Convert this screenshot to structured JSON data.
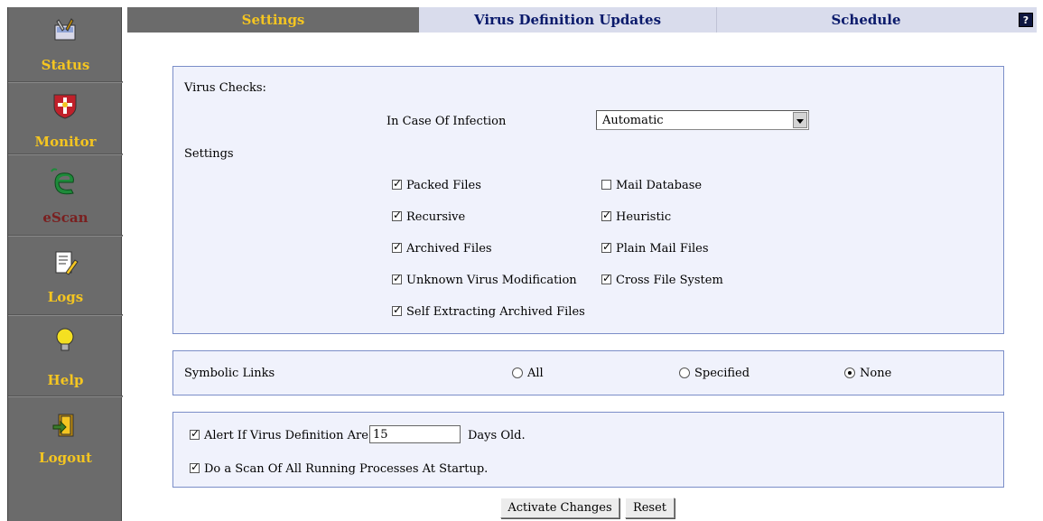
{
  "sidebar": {
    "items": [
      {
        "label": "Status",
        "icon": "tools-icon",
        "color": "#f4c521"
      },
      {
        "label": "Monitor",
        "icon": "shield-icon",
        "color": "#f4c521"
      },
      {
        "label": "eScan",
        "icon": "escan-logo-icon",
        "color": "#7a1f1f"
      },
      {
        "label": "Logs",
        "icon": "document-pencil-icon",
        "color": "#f4c521"
      },
      {
        "label": "Help",
        "icon": "lightbulb-icon",
        "color": "#f4c521"
      },
      {
        "label": "Logout",
        "icon": "door-exit-icon",
        "color": "#f4c521"
      }
    ]
  },
  "tabs": {
    "settings": "Settings",
    "virus_updates": "Virus Definition Updates",
    "schedule": "Schedule",
    "help": "?"
  },
  "virus_checks": {
    "heading": "Virus Checks:",
    "infection_label": "In Case Of Infection",
    "infection_value": "Automatic",
    "settings_heading": "Settings",
    "options": {
      "packed_files": {
        "label": "Packed Files",
        "checked": true
      },
      "mail_database": {
        "label": "Mail Database",
        "checked": false
      },
      "recursive": {
        "label": "Recursive",
        "checked": true
      },
      "heuristic": {
        "label": "Heuristic",
        "checked": true
      },
      "archived_files": {
        "label": "Archived Files",
        "checked": true
      },
      "plain_mail_files": {
        "label": "Plain Mail Files",
        "checked": true
      },
      "unknown_virus_mod": {
        "label": "Unknown Virus Modification",
        "checked": true
      },
      "cross_file_system": {
        "label": "Cross File System",
        "checked": true
      },
      "self_extracting": {
        "label": "Self Extracting Archived Files",
        "checked": true
      }
    }
  },
  "symbolic_links": {
    "label": "Symbolic Links",
    "options": {
      "all": "All",
      "specified": "Specified",
      "none": "None"
    },
    "selected": "none"
  },
  "alerts": {
    "alert_prefix": "Alert If Virus Definition Are",
    "alert_days": "15",
    "alert_suffix": "Days Old.",
    "alert_checked": true,
    "scan_startup": "Do a Scan Of All Running Processes At Startup.",
    "scan_checked": true
  },
  "buttons": {
    "activate": "Activate Changes",
    "reset": "Reset"
  },
  "colors": {
    "sidebar_bg": "#6b6b6b",
    "active_tab_text": "#f4c521",
    "inactive_tab_bg": "#d9dcec",
    "inactive_tab_text": "#0a1a6b",
    "panel_bg": "#f0f2fc",
    "panel_border": "#7b8ec8"
  }
}
